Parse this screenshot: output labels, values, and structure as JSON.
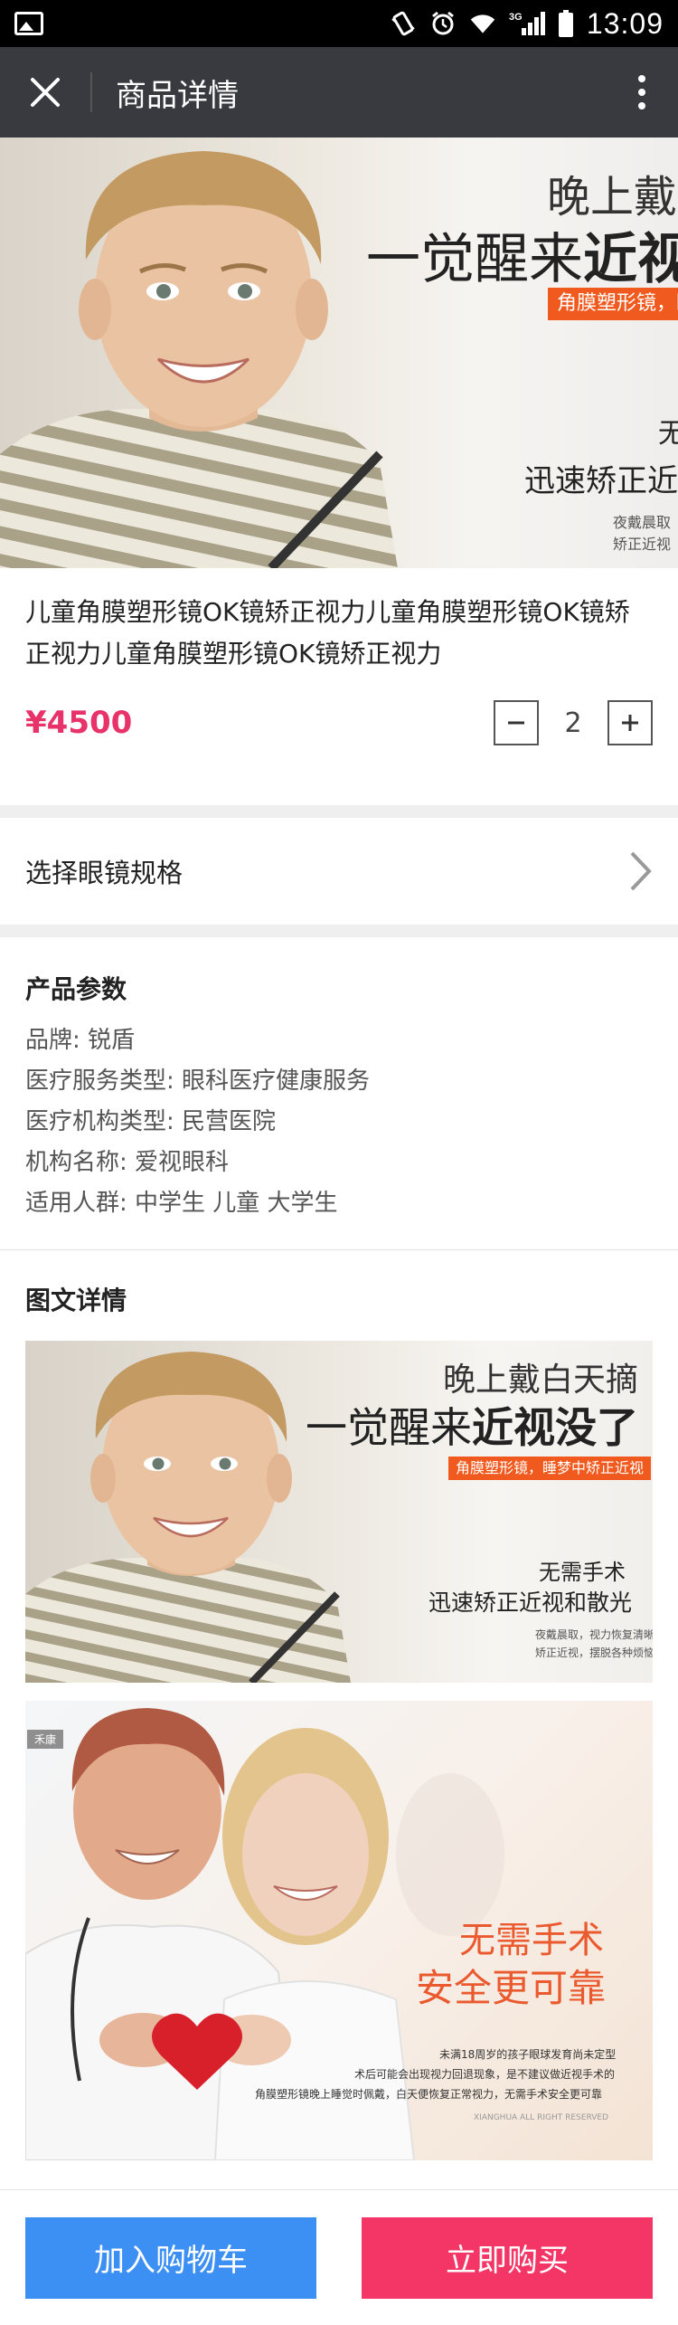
{
  "status_bar": {
    "time": "13:09",
    "network": "3G",
    "icons": [
      "image-icon",
      "vibrate-icon",
      "alarm-icon",
      "wifi-icon",
      "signal-icon",
      "battery-icon"
    ]
  },
  "header": {
    "title": "商品详情",
    "close_icon": "close-icon",
    "more_icon": "more-vertical-icon"
  },
  "hero": {
    "line1": "晚上戴",
    "line2_a": "一觉醒来",
    "line2_b": "近视",
    "tag": "角膜塑形镜，睡",
    "line3": "迅速矫正近",
    "line3_top": "无",
    "small1": "夜戴晨取",
    "small2": "矫正近视"
  },
  "product": {
    "title": "儿童角膜塑形镜OK镜矫正视力儿童角膜塑形镜OK镜矫正视力儿童角膜塑形镜OK镜矫正视力",
    "price": "¥4500",
    "quantity": "2"
  },
  "spec": {
    "label": "选择眼镜规格"
  },
  "params": {
    "title": "产品参数",
    "items": [
      "品牌: 锐盾",
      "医疗服务类型: 眼科医疗健康服务",
      "医疗机构类型: 民营医院",
      "机构名称: 爱视眼科",
      "适用人群: 中学生 儿童 大学生"
    ]
  },
  "detail": {
    "title": "图文详情",
    "img1": {
      "line1": "晚上戴白天摘",
      "line2_a": "一觉醒来",
      "line2_b": "近视没了",
      "tag": "角膜塑形镜，睡梦中矫正近视",
      "line3": "无需手术",
      "line4": "迅速矫正近视和散光",
      "small1": "夜戴晨取，视力恢复清晰",
      "small2": "矫正近视，摆脱各种烦恼"
    },
    "img2": {
      "corner": "禾康",
      "line1": "无需手术",
      "line2": "安全更可靠",
      "small1": "未满18周岁的孩子眼球发育尚未定型",
      "small2": "术后可能会出现视力回退现象，是不建议做近视手术的",
      "small3": "角膜塑形镜晚上睡觉时佩戴，白天便恢复正常视力，无需手术安全更可靠",
      "footer": "XIANGHUA ALL RIGHT RESERVED"
    }
  },
  "actions": {
    "add_to_cart": "加入购物车",
    "buy_now": "立即购买"
  },
  "colors": {
    "price": "#e8326a",
    "cart_button": "#3c8ff3",
    "buy_button": "#f43667",
    "header_bg": "#393a3f",
    "tag_orange": "#f05a1e"
  }
}
